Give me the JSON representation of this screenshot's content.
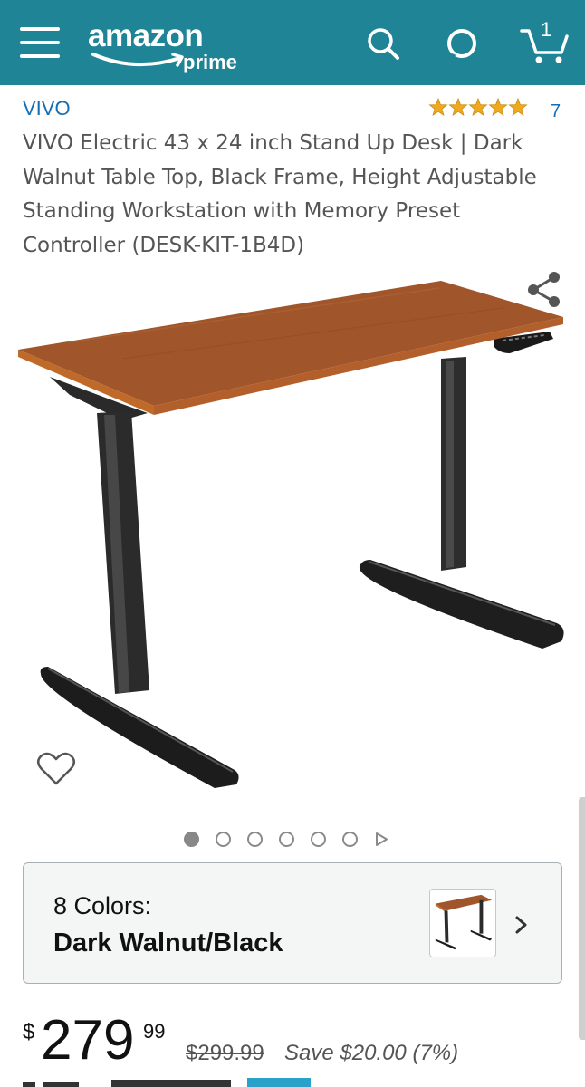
{
  "header": {
    "logo_text": "amazon",
    "logo_sub": "prime",
    "cart_count": "1",
    "icons": [
      "menu-icon",
      "search-icon",
      "alexa-icon",
      "cart-icon"
    ],
    "colors": {
      "bar": "#1f8596",
      "icon": "#ffffff"
    }
  },
  "product": {
    "brand": "VIVO",
    "rating_stars": 5,
    "rating_count": "7",
    "title": "VIVO Electric 43 x 24 inch Stand Up Desk | Dark Walnut Table Top, Black Frame, Height Adjustable Standing Workstation with Memory Preset Controller (DESK-KIT-1B4D)"
  },
  "gallery": {
    "image_count": 6,
    "active_index": 0,
    "icons": [
      "share-icon",
      "heart-icon",
      "play-next-icon"
    ]
  },
  "color_selector": {
    "count_label": "8 Colors:",
    "selected": "Dark Walnut/Black"
  },
  "price": {
    "currency": "$",
    "whole": "279",
    "fraction": "99",
    "list_price": "$299.99",
    "savings": "Save $20.00 (7%)"
  },
  "colors": {
    "link": "#146eb4",
    "star": "#f0a81c",
    "desk_top": "#a0552a",
    "frame": "#2b2b2b"
  }
}
